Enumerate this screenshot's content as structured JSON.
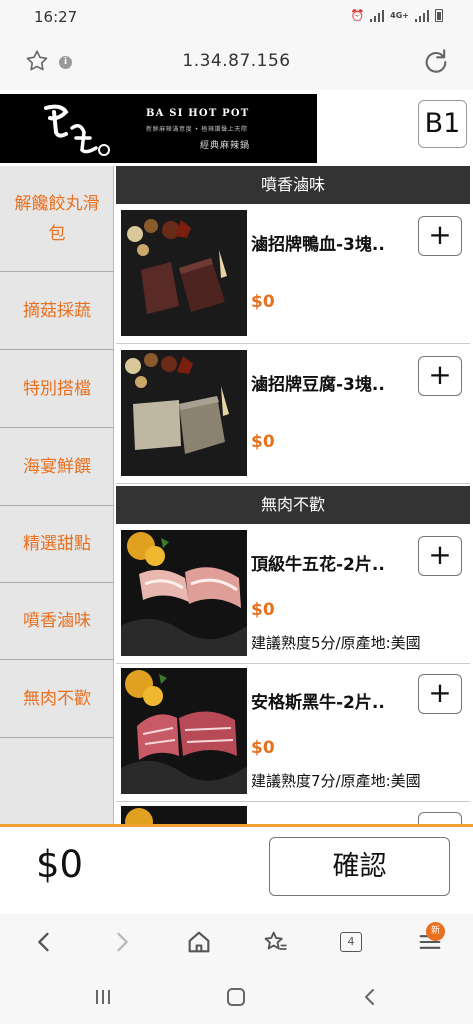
{
  "status_bar": {
    "time": "16:27",
    "network": "4G+"
  },
  "browser": {
    "url": "1.34.87.156"
  },
  "header": {
    "brand": "BA SI HOT POT",
    "tagline": "新鮮麻辣滿意度 • 極辣讚聲上天際",
    "subtitle": "經典麻辣鍋",
    "table_id": "B1"
  },
  "sidebar": {
    "items": [
      {
        "label": "解饞餃丸滑包"
      },
      {
        "label": "摘菇採蔬"
      },
      {
        "label": "特別搭檔"
      },
      {
        "label": "海宴鮮饌"
      },
      {
        "label": "精選甜點"
      },
      {
        "label": "噴香滷味"
      },
      {
        "label": "無肉不歡"
      }
    ]
  },
  "sections": [
    {
      "title": "噴香滷味"
    },
    {
      "title": "無肉不歡"
    }
  ],
  "items": [
    {
      "name": "滷招牌鴨血-3塊..",
      "price": "$0",
      "add_label": "+"
    },
    {
      "name": "滷招牌豆腐-3塊..",
      "price": "$0",
      "add_label": "+"
    },
    {
      "name": "頂級牛五花-2片..",
      "price": "$0",
      "note": "建議熟度5分/原產地:美國",
      "add_label": "+"
    },
    {
      "name": "安格斯黑牛-2片..",
      "price": "$0",
      "note": "建議熟度7分/原產地:美國",
      "add_label": "+"
    }
  ],
  "bottom": {
    "total": "$0",
    "confirm_label": "確認"
  },
  "nav": {
    "tab_count": "4",
    "menu_badge": "新"
  },
  "colors": {
    "accent": "#e8701f",
    "section_header": "#333333",
    "sidebar_bg": "#e6e6e6"
  }
}
